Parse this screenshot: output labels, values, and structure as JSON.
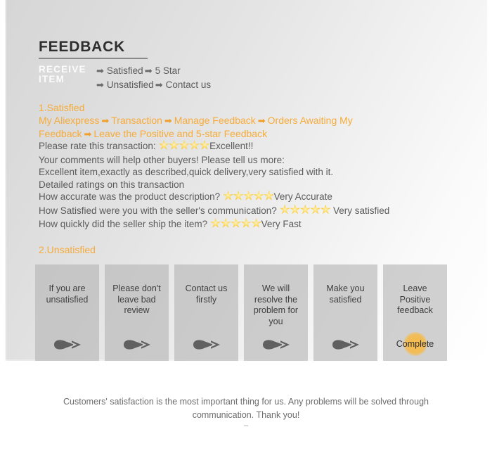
{
  "page": {
    "heading": "FEEDBACK"
  },
  "receive": {
    "label": "RECEIVE ITEM",
    "rows": [
      {
        "arrow": "➡",
        "first": "Satisfied",
        "arrow2": "➡",
        "second": "5 Star"
      },
      {
        "arrow": "➡",
        "first": "Unsatisfied",
        "arrow2": "➡",
        "second": "Contact us"
      }
    ]
  },
  "satisfied": {
    "title": "1.Satisfied",
    "path_steps": [
      "My Aliexpress",
      "Transaction",
      "Manage Feedback",
      "Orders Awaiting My Feedback",
      "Leave the Positive and 5-star Feedback"
    ],
    "path_arrow": "➡",
    "rate_prompt": "Please rate this transaction:",
    "rate_stars": 5,
    "rate_value": "Excellent!!",
    "comments_prompt": "Your comments will help other buyers! Please tell us more:",
    "comment_text": "Excellent item,exactly as described,quick delivery,very satisfied with it.",
    "detailed_header": "Detailed ratings on this transaction",
    "detailed": [
      {
        "question": "How accurate was the product description?",
        "stars": 5,
        "value": "Very Accurate"
      },
      {
        "question": "How Satisfied were you with the seller's communication?",
        "stars": 5,
        "value": " Very satisfied"
      },
      {
        "question": "How quickly did the seller ship the item?",
        "stars": 5,
        "value": "Very Fast"
      }
    ]
  },
  "unsatisfied": {
    "title": "2.Unsatisfied",
    "cards": [
      {
        "text": "If you are unsatisfied",
        "icon": "arrow-right-icon"
      },
      {
        "text": "Please don't leave bad review",
        "icon": "arrow-right-icon"
      },
      {
        "text": "Contact us firstly",
        "icon": "arrow-right-icon"
      },
      {
        "text": "We will resolve the problem for you",
        "icon": "arrow-right-icon"
      },
      {
        "text": "Make you satisfied",
        "icon": "arrow-right-icon"
      },
      {
        "text": "Leave Positive feedback",
        "icon": "complete-badge",
        "badge": "Complete"
      }
    ]
  },
  "footer": {
    "text": "Customers' satisfaction is the most important thing for us. Any problems will be solved through communication. Thank you!",
    "dash": "–"
  },
  "colors": {
    "accent_orange": "#f6ab3a",
    "star_gold": "#f4c020",
    "body_text": "#5b5b5b",
    "card_bg": "#b5b5b5"
  }
}
